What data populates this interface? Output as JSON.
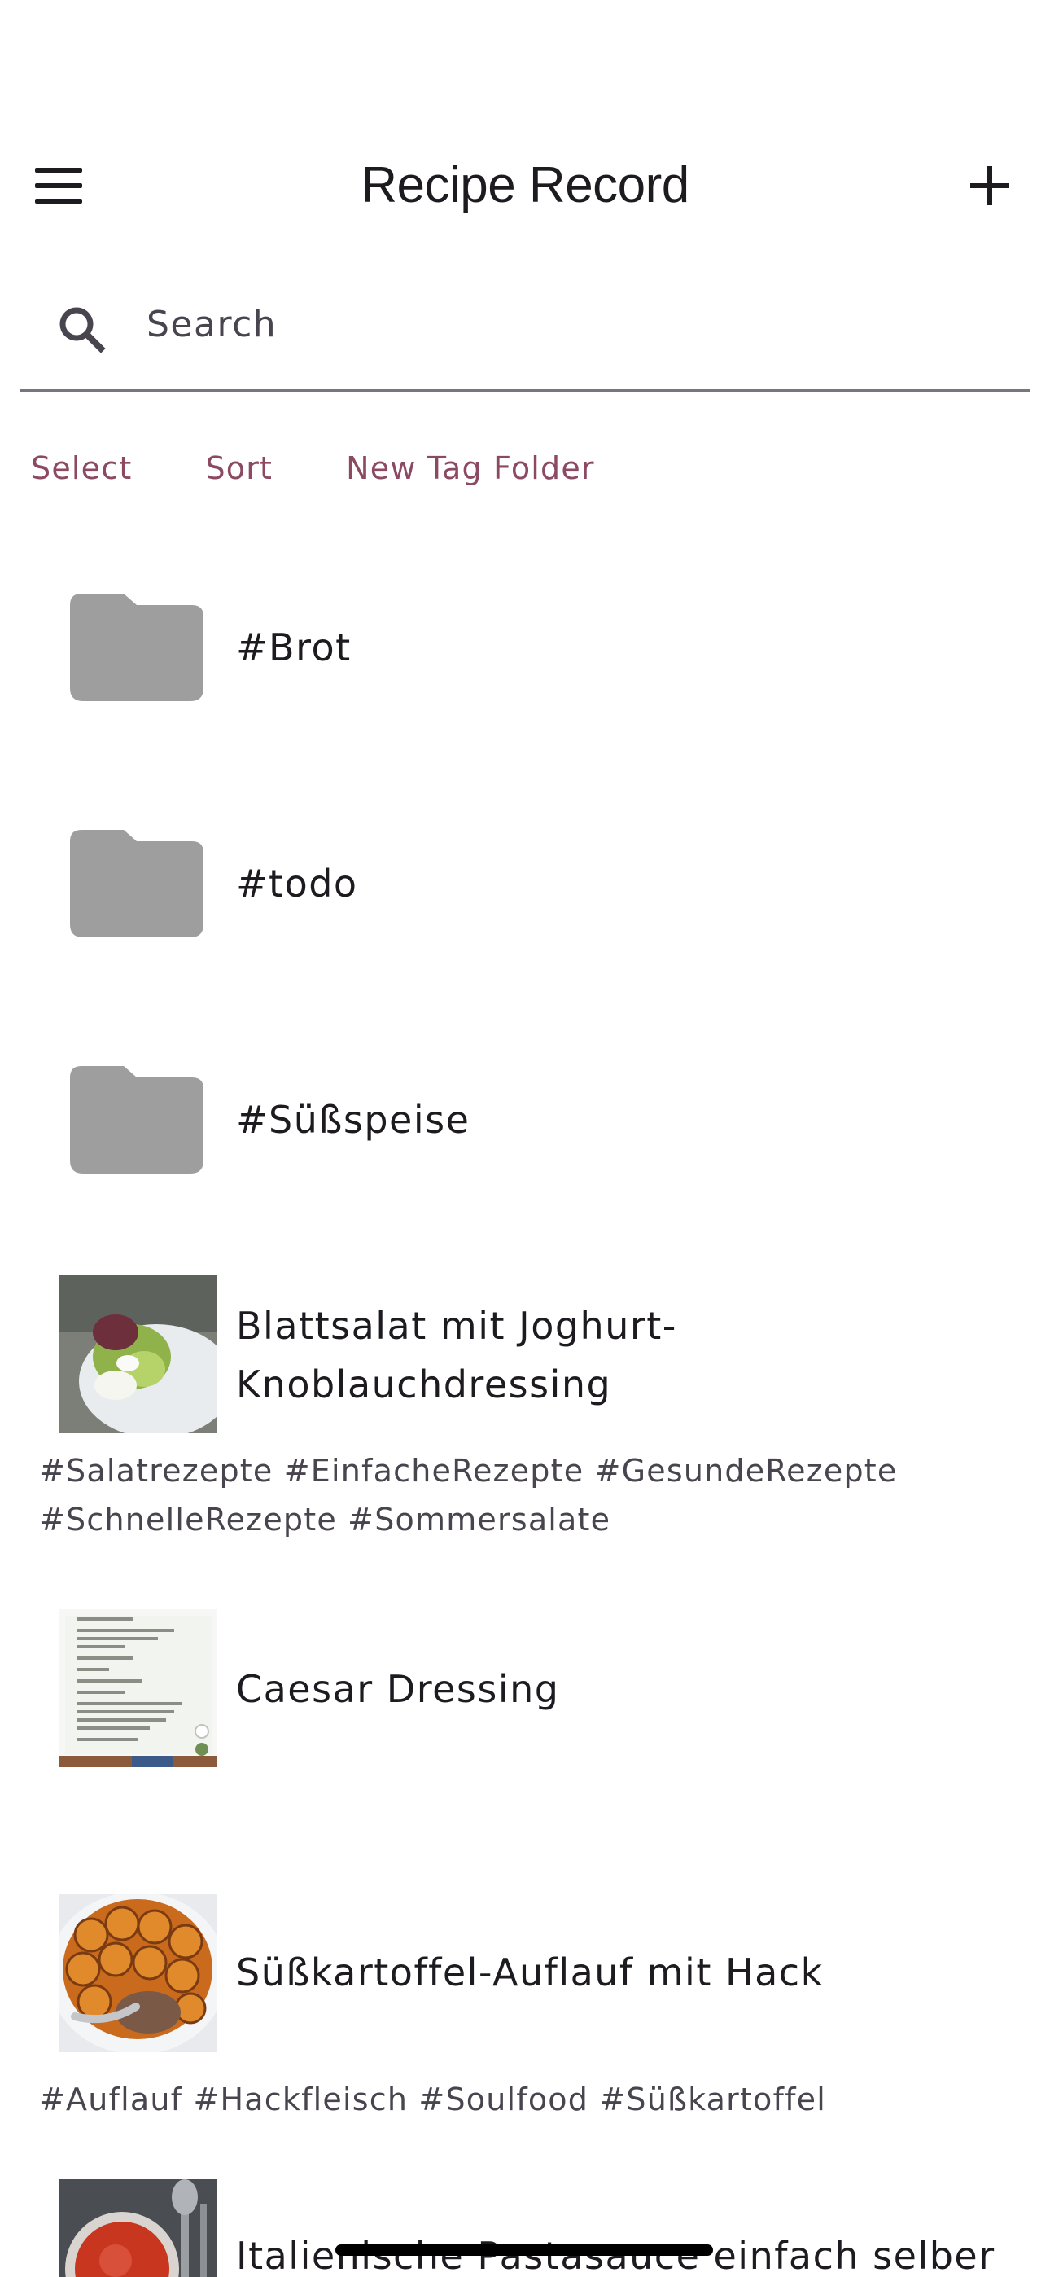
{
  "header": {
    "title": "Recipe Record",
    "menu_icon": "menu-icon",
    "add_icon": "plus-icon"
  },
  "search": {
    "placeholder": "Search",
    "value": "",
    "icon": "search-icon"
  },
  "actions": {
    "select": "Select",
    "sort": "Sort",
    "new_tag_folder": "New Tag Folder"
  },
  "folders": [
    {
      "label": "#Brot",
      "icon": "folder-icon"
    },
    {
      "label": "#todo",
      "icon": "folder-icon"
    },
    {
      "label": "#Süßspeise",
      "icon": "folder-icon"
    }
  ],
  "recipes": [
    {
      "title": "Blattsalat mit Joghurt-Knoblauchdressing",
      "tags": "#Salatrezepte #EinfacheRezepte #GesundeRezepte #SchnelleRezepte #Sommersalate"
    },
    {
      "title": "Caesar Dressing",
      "tags": ""
    },
    {
      "title": "Süßkartoffel-Auflauf mit Hack",
      "tags": "#Auflauf #Hackfleisch #Soulfood #Süßkartoffel"
    },
    {
      "title": "Italienische Pastasauce einfach selber",
      "tags": ""
    }
  ],
  "colors": {
    "accent": "#8b4a62",
    "folder": "#9e9e9e",
    "divider": "#79747e"
  }
}
